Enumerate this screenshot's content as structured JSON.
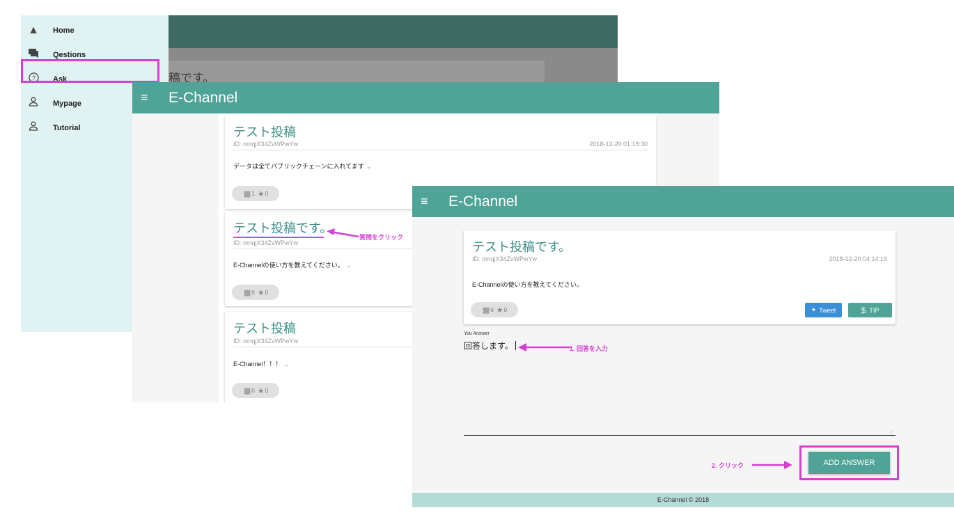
{
  "drawer": {
    "bg_title": "稿です。",
    "items": [
      {
        "label": "Home",
        "icon": "home-icon"
      },
      {
        "label": "Qestions",
        "icon": "forum-icon"
      },
      {
        "label": "Ask",
        "icon": "help-circle-icon"
      },
      {
        "label": "Mypage",
        "icon": "person-icon"
      },
      {
        "label": "Tutorial",
        "icon": "person-icon"
      }
    ]
  },
  "list_screen": {
    "brand": "E-Channel",
    "cards": [
      {
        "title": "テスト投稿",
        "id": "ID: nmqjX34ZvWPwYw",
        "date": "2018-12-20 01:18:30",
        "body": "データは全てパブリックチェーンに入れてます",
        "comments": "1",
        "stars": "0"
      },
      {
        "title": "テスト投稿です。",
        "id": "ID: nmqjX34ZvWPwYw",
        "date": "",
        "body": "E-Channelの使い方を教えてください。",
        "comments": "0",
        "stars": "0"
      },
      {
        "title": "テスト投稿",
        "id": "ID: nmqjX34ZvWPwYw",
        "date": "",
        "body": "E-Channel！！！",
        "comments": "0",
        "stars": "0"
      }
    ]
  },
  "detail_screen": {
    "brand": "E-Channel",
    "card": {
      "title": "テスト投稿です。",
      "id": "ID: nmqjX34ZvWPwYw",
      "date": "2018-12-20 04:14:19",
      "body": "E-Channelの使い方を教えてください。",
      "comments": "0",
      "stars": "0"
    },
    "tweet_label": "Tweet",
    "tip_label": "TIP",
    "answer_label": "You Answer",
    "answer_value": "回答します。",
    "add_button": "ADD ANSWER",
    "footer": "E-Channel © 2018"
  },
  "annotations": {
    "click_question": "質問をクリック",
    "step1": "1. 回答を入力",
    "step2": "2. クリック"
  },
  "colors": {
    "accent": "#4fa397",
    "highlight": "#d63fd1",
    "tweet": "#3a8fd6",
    "footer": "#b5dbd6"
  }
}
